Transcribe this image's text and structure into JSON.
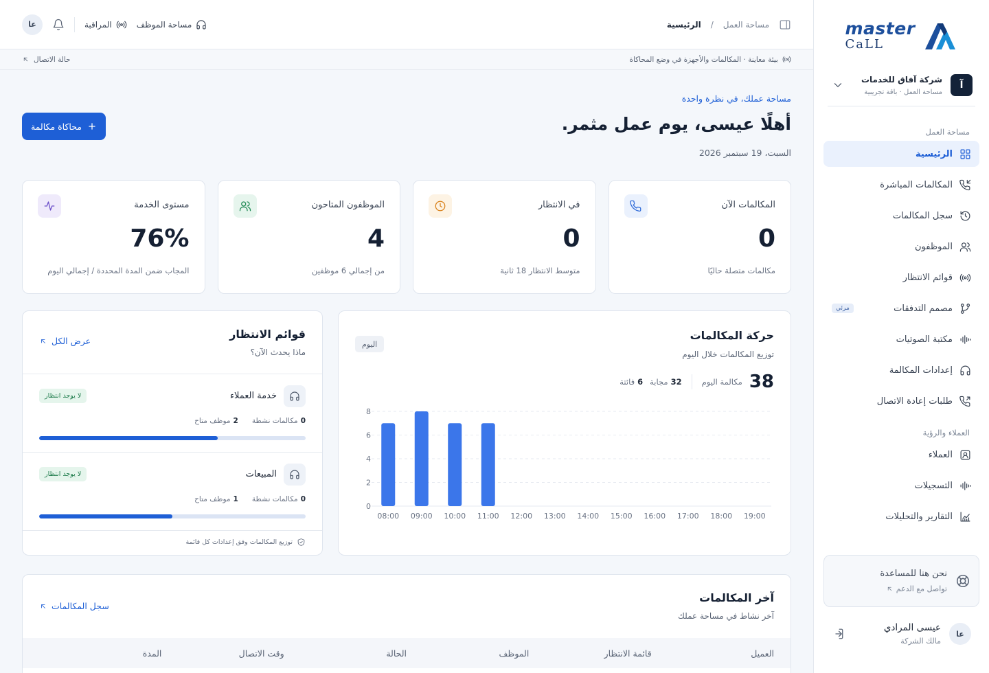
{
  "brand": {
    "line1": "master",
    "line2": "CaLL"
  },
  "org": {
    "badge": "آ",
    "name": "شركة آفاق للخدمات",
    "sub": "مساحة العمل · باقة تجريبية"
  },
  "sidebar": {
    "section_workspace": "مساحة العمل",
    "workspace_items": [
      {
        "label": "الرئيسية",
        "icon": "grid-icon"
      },
      {
        "label": "المكالمات المباشرة",
        "icon": "phone-incoming-icon"
      },
      {
        "label": "سجل المكالمات",
        "icon": "history-icon"
      },
      {
        "label": "الموظفون",
        "icon": "users-icon"
      },
      {
        "label": "قوائم الانتظار",
        "icon": "broadcast-icon"
      },
      {
        "label": "مصمم التدفقات",
        "icon": "flow-icon",
        "badge": "مرئي"
      },
      {
        "label": "مكتبة الصوتيات",
        "icon": "audio-wave-icon"
      },
      {
        "label": "إعدادات المكالمة",
        "icon": "headphones-icon"
      },
      {
        "label": "طلبات إعادة الاتصال",
        "icon": "phone-callback-icon"
      }
    ],
    "section_customers": "العملاء والرؤية",
    "customer_items": [
      {
        "label": "العملاء",
        "icon": "contact-icon"
      },
      {
        "label": "التسجيلات",
        "icon": "audio-wave-icon"
      },
      {
        "label": "التقارير والتحليلات",
        "icon": "chart-icon"
      }
    ],
    "help_title": "نحن هنا للمساعدة",
    "help_sub": "تواصل مع الدعم",
    "user_initials": "عا",
    "user_name": "عيسى المرادي",
    "user_role": "مالك الشركة"
  },
  "topbar": {
    "crumb_workspace": "مساحة العمل",
    "crumb_sep": "/",
    "crumb_current": "الرئيسية",
    "agent_space": "مساحة الموظف",
    "monitoring": "المراقبة",
    "avatar": "عا"
  },
  "statusbar": {
    "env": "بيئة معاينة · المكالمات والأجهزة في وضع المحاكاة",
    "connection": "حالة الاتصال"
  },
  "hero": {
    "eyebrow": "مساحة عملك، في نظرة واحدة",
    "greeting": "أهلًا عيسى، يوم عمل مثمر.",
    "date": "السبت، 19 سبتمبر 2026",
    "cta": "محاكاة مكالمة"
  },
  "stats": [
    {
      "label": "المكالمات الآن",
      "value": "0",
      "hint": "مكالمات متصلة حاليًا",
      "icon": "phone-icon",
      "color": "#2f6bd8",
      "bg": "#eaf1fd"
    },
    {
      "label": "في الانتظار",
      "value": "0",
      "hint": "متوسط الانتظار 18 ثانية",
      "icon": "clock-icon",
      "color": "#d9821b",
      "bg": "#fdf3e4"
    },
    {
      "label": "الموظفون المتاحون",
      "value": "4",
      "hint": "من إجمالي 6 موظفين",
      "icon": "users-icon",
      "color": "#1f8a54",
      "bg": "#e6f5ed"
    },
    {
      "label": "مستوى الخدمة",
      "value": "76%",
      "hint": "المجاب ضمن المدة المحددة / إجمالي اليوم",
      "icon": "activity-icon",
      "color": "#6b4fc9",
      "bg": "#efeafb"
    }
  ],
  "traffic": {
    "title": "حركة المكالمات",
    "subtitle": "توزيع المكالمات خلال اليوم",
    "period": "اليوم",
    "total": "38",
    "total_label": "مكالمة اليوم",
    "answered": "32",
    "answered_label": "مجابة",
    "missed": "6",
    "missed_label": "فائتة"
  },
  "chart_data": {
    "type": "bar",
    "categories": [
      "08:00",
      "09:00",
      "10:00",
      "11:00",
      "12:00",
      "13:00",
      "14:00",
      "15:00",
      "16:00",
      "17:00",
      "18:00",
      "19:00"
    ],
    "values": [
      7,
      8,
      7,
      7,
      0,
      0,
      0,
      0,
      0,
      0,
      0,
      0
    ],
    "ylim": [
      0,
      8
    ],
    "yticks": [
      0,
      2,
      4,
      6,
      8
    ],
    "grid": true,
    "color": "#3b76ea"
  },
  "queues": {
    "title": "قوائم الانتظار",
    "subtitle": "ماذا يحدث الآن؟",
    "view_all": "عرض الكل",
    "items": [
      {
        "name": "خدمة العملاء",
        "badge": "لا يوجد انتظار",
        "active": "0",
        "active_label": "مكالمات نشطة",
        "available": "2",
        "available_label": "موظف متاح",
        "load": 0.67
      },
      {
        "name": "المبيعات",
        "badge": "لا يوجد انتظار",
        "active": "0",
        "active_label": "مكالمات نشطة",
        "available": "1",
        "available_label": "موظف متاح",
        "load": 0.5
      }
    ],
    "footer": "توزيع المكالمات وفق إعدادات كل قائمة"
  },
  "recent": {
    "title": "آخر المكالمات",
    "subtitle": "آخر نشاط في مساحة عملك",
    "link": "سجل المكالمات",
    "columns": [
      "العميل",
      "قائمة الانتظار",
      "الموظف",
      "الحالة",
      "وقت الاتصال",
      "المدة"
    ]
  }
}
